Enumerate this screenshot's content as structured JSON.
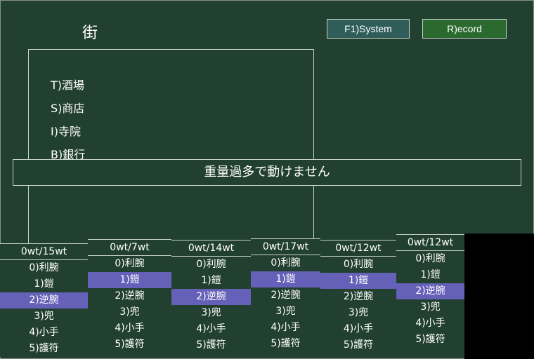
{
  "location": {
    "title": "街"
  },
  "buttons": {
    "system": "F1)System",
    "record": "R)ecord"
  },
  "town_menu": [
    "T)酒場",
    "S)商店",
    "I)寺院",
    "B)銀行"
  ],
  "message": "重量過多で動けません",
  "parties": [
    {
      "weight": "0wt/15wt",
      "items": [
        "0)利腕",
        "1)鎧",
        "2)逆腕",
        "3)兜",
        "4)小手",
        "5)護符"
      ],
      "selected": 2
    },
    {
      "weight": "0wt/7wt",
      "items": [
        "0)利腕",
        "1)鎧",
        "2)逆腕",
        "3)兜",
        "4)小手",
        "5)護符"
      ],
      "selected": 1
    },
    {
      "weight": "0wt/14wt",
      "items": [
        "0)利腕",
        "1)鎧",
        "2)逆腕",
        "3)兜",
        "4)小手",
        "5)護符"
      ],
      "selected": 2
    },
    {
      "weight": "0wt/17wt",
      "items": [
        "0)利腕",
        "1)鎧",
        "2)逆腕",
        "3)兜",
        "4)小手",
        "5)護符"
      ],
      "selected": 1
    },
    {
      "weight": "0wt/12wt",
      "items": [
        "0)利腕",
        "1)鎧",
        "2)逆腕",
        "3)兜",
        "4)小手",
        "5)護符"
      ],
      "selected": 1
    },
    {
      "weight": "0wt/12wt",
      "items": [
        "0)利腕",
        "1)鎧",
        "2)逆腕",
        "3)兜",
        "4)小手",
        "5)護符"
      ],
      "selected": 2
    }
  ]
}
